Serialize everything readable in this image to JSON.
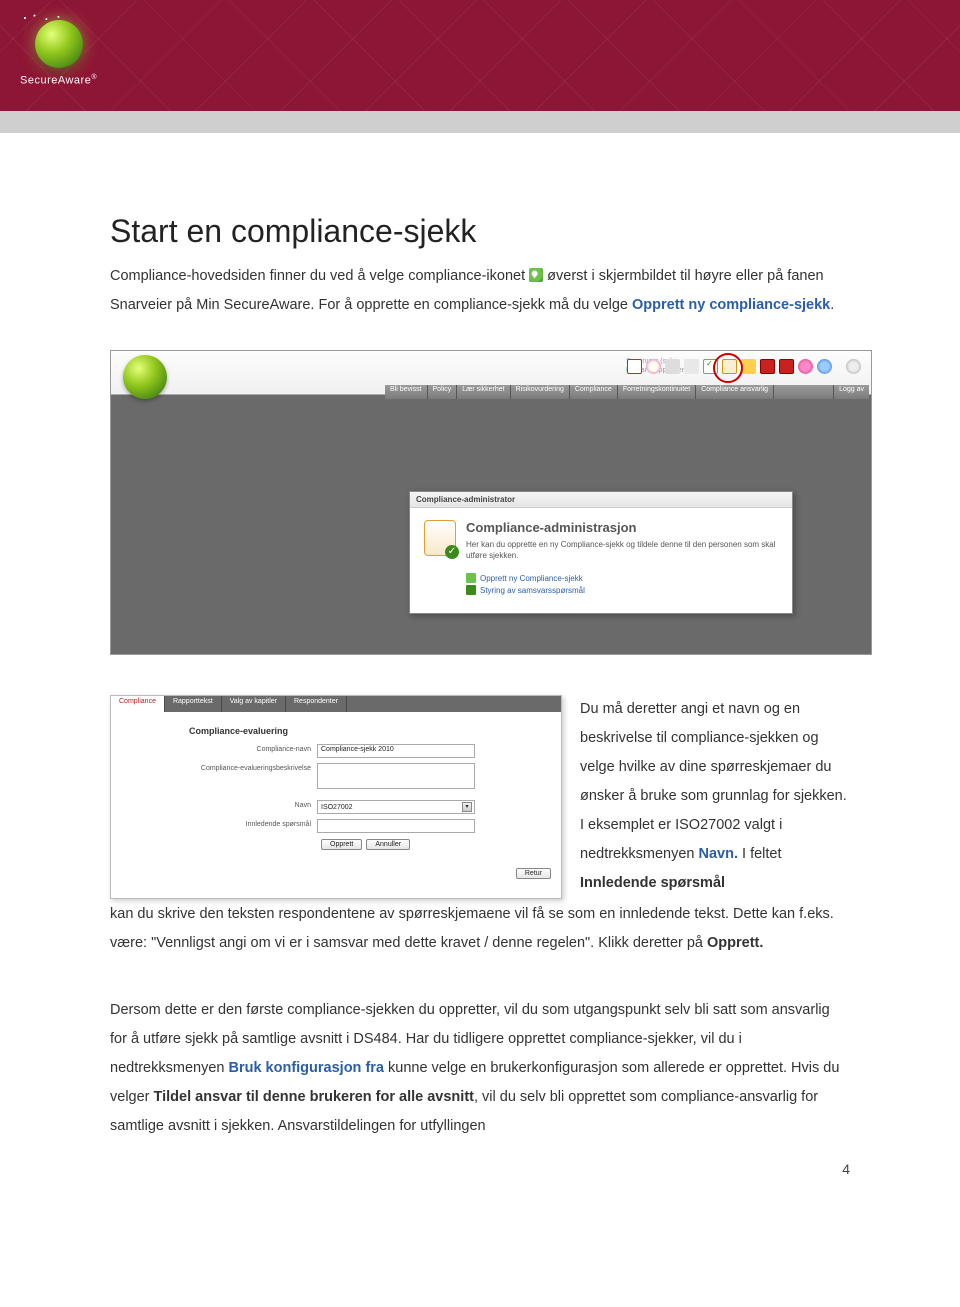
{
  "header": {
    "brand": "SecureAware"
  },
  "title": "Start en compliance-sjekk",
  "intro": {
    "part1": "Compliance-hovedsiden finner du ved å velge compliance-ikonet ",
    "part2": "øverst i skjermbildet til høyre eller på fanen Snarveier på Min SecureAware. For å opprette en compliance-sjekk må du velge ",
    "link": "Opprett ny compliance-sjekk",
    "part3": "."
  },
  "shot1": {
    "usertext_l1": "Superuser (su)",
    "usertext_l2": "Du har 0 oppgaver",
    "menu": [
      "Bli bevisst",
      "Policy",
      "Lær sikkerhet",
      "Risikovurdering",
      "Compliance",
      "Forretningskontinuitet",
      "Compliance ansvarlig",
      "Logg av"
    ],
    "dialog": {
      "title": "Compliance-administrator",
      "heading": "Compliance-administrasjon",
      "desc": "Her kan du opprette en ny Compliance-sjekk og tildele denne til den personen som skal utføre sjekken.",
      "link1": "Opprett ny Compliance-sjekk",
      "link2": "Styring av samsvarsspørsmål"
    }
  },
  "shot2": {
    "tabs": [
      "Compliance",
      "Rapporttekst",
      "Valg av kapitler",
      "Respondenter"
    ],
    "heading": "Compliance-evaluering",
    "fields": {
      "name_label": "Compliance-navn",
      "name_value": "Compliance-sjekk 2010",
      "desc_label": "Compliance-evalueringsbeskrivelse",
      "select_label": "Navn",
      "select_value": "ISO27002",
      "intro_label": "Innledende spørsmål"
    },
    "opprett_btn": "Opprett",
    "annuller_btn": "Annuller",
    "retur_btn": "Retur"
  },
  "para2": {
    "t1": " Du må deretter angi et navn og en beskrivelse til compliance-sjekken og velge hvilke av dine spørreskjemaer du ønsker å bruke som grunnlag for sjekken. I eksemplet er ISO27002 valgt i nedtrekksmenyen ",
    "navn": "Navn.",
    "t2": " I feltet ",
    "innled": "Innledende spørsmål",
    "t3": " kan du skrive den teksten respondentene av spørreskjemaene vil få se som en innledende tekst. Dette kan f.eks. være: \"Vennligst angi om vi er i samsvar med dette kravet / denne regelen\". Klikk deretter på ",
    "opprett": "Opprett."
  },
  "para3": {
    "t1": "Dersom dette er den første compliance-sjekken du oppretter, vil du som utgangspunkt selv bli satt som ansvarlig for å utføre sjekk på samtlige avsnitt i DS484. Har du tidligere opprettet compliance-sjekker, vil du i nedtrekksmenyen ",
    "bruk": "Bruk konfigurasjon fra",
    "t2": " kunne velge en brukerkonfigurasjon som allerede er opprettet. Hvis du velger ",
    "tildel": "Tildel ansvar til denne brukeren for alle avsnitt",
    "t3": ", vil du selv bli opprettet som compliance-ansvarlig for samtlige avsnitt i sjekken. Ansvarstildelingen for utfyllingen"
  },
  "pagenum": "4"
}
